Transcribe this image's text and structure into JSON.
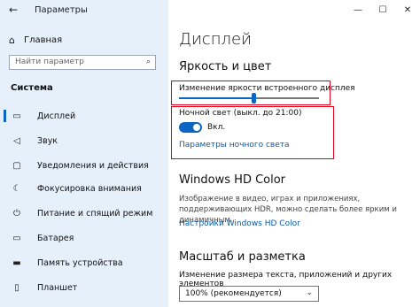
{
  "window": {
    "app_title": "Параметры",
    "back_icon": "back-arrow-icon"
  },
  "window_controls": {
    "minimize": "—",
    "maximize": "☐",
    "close": "✕"
  },
  "sidebar": {
    "home_label": "Главная",
    "search_placeholder": "Найти параметр",
    "section_title": "Система",
    "items": [
      {
        "label": "Дисплей",
        "icon": "monitor-icon",
        "glyph": "▭",
        "active": true
      },
      {
        "label": "Звук",
        "icon": "speaker-icon",
        "glyph": "🔊",
        "active": false
      },
      {
        "label": "Уведомления и действия",
        "icon": "notification-icon",
        "glyph": "▢",
        "active": false
      },
      {
        "label": "Фокусировка внимания",
        "icon": "moon-icon",
        "glyph": "☾",
        "active": false
      },
      {
        "label": "Питание и спящий режим",
        "icon": "power-icon",
        "glyph": "⏻",
        "active": false
      },
      {
        "label": "Батарея",
        "icon": "battery-icon",
        "glyph": "▭",
        "active": false
      },
      {
        "label": "Память устройства",
        "icon": "storage-icon",
        "glyph": "▬",
        "active": false
      },
      {
        "label": "Планшет",
        "icon": "tablet-icon",
        "glyph": "▯",
        "active": false
      }
    ]
  },
  "main": {
    "page_title": "Дисплей",
    "brightness_section": "Яркость и цвет",
    "brightness_label": "Изменение яркости встроенного дисплея",
    "brightness_level": 0.53,
    "night_light_label": "Ночной свет (выкл. до 21:00)",
    "night_light_toggle": "Вкл.",
    "night_light_link": "Параметры ночного света",
    "hdr_section": "Windows HD Color",
    "hdr_description": "Изображение в видео, играх и приложениях, поддерживающих HDR, можно сделать более ярким и динамичным.",
    "hdr_link": "Настройки Windows HD Color",
    "scale_section": "Масштаб и разметка",
    "scale_label": "Изменение размера текста, приложений и других элементов",
    "scale_value": "100% (рекомендуется)"
  },
  "colors": {
    "accent": "#0a66c2",
    "highlight_box": "#e0001a",
    "sidebar_bg": "#e6f0fb"
  }
}
